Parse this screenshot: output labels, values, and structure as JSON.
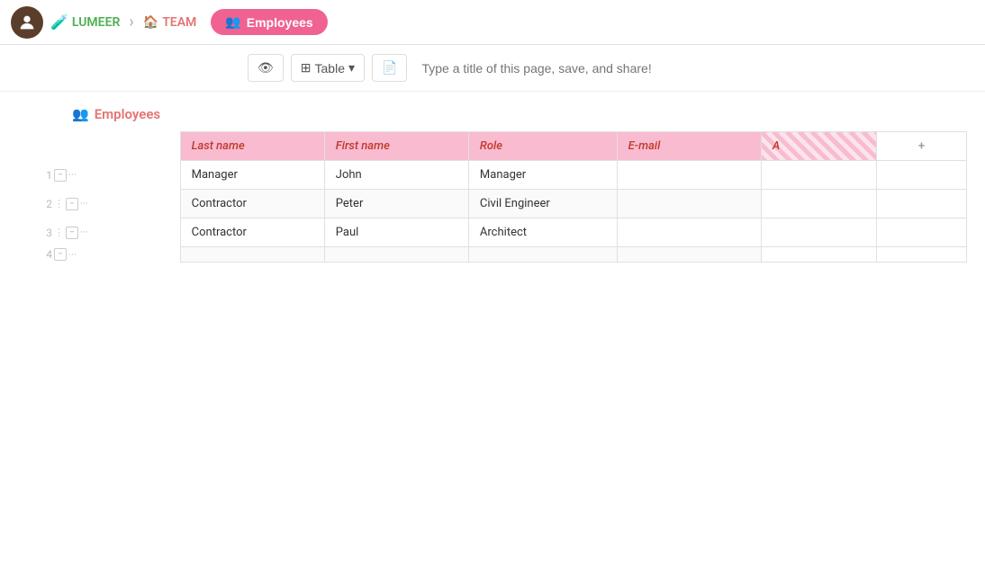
{
  "nav": {
    "brand": "LUMEER",
    "separator": "›",
    "team": "TEAM",
    "tab_label": "Employees"
  },
  "toolbar": {
    "view_icon": "👁",
    "table_label": "Table",
    "dropdown_icon": "▾",
    "save_icon": "💾",
    "title_placeholder": "Type a title of this page, save, and share!"
  },
  "collection": {
    "icon": "👥",
    "name": "Employees"
  },
  "table": {
    "columns": [
      {
        "label": "Last name",
        "key": "last_name"
      },
      {
        "label": "First name",
        "key": "first_name"
      },
      {
        "label": "Role",
        "key": "role"
      },
      {
        "label": "E-mail",
        "key": "email"
      },
      {
        "label": "A",
        "key": "a",
        "striped": true
      }
    ],
    "add_button": "+",
    "rows": [
      {
        "num": "1",
        "last_name": "Manager",
        "first_name": "John",
        "role": "Manager",
        "email": "",
        "a": "",
        "has_handle": false
      },
      {
        "num": "2",
        "last_name": "Contractor",
        "first_name": "Peter",
        "role": "Civil Engineer",
        "email": "",
        "a": "",
        "has_handle": true
      },
      {
        "num": "3",
        "last_name": "Contractor",
        "first_name": "Paul",
        "role": "Architect",
        "email": "",
        "a": "",
        "has_handle": true
      },
      {
        "num": "4",
        "last_name": "",
        "first_name": "",
        "role": "",
        "email": "",
        "a": "",
        "has_handle": false
      }
    ]
  }
}
